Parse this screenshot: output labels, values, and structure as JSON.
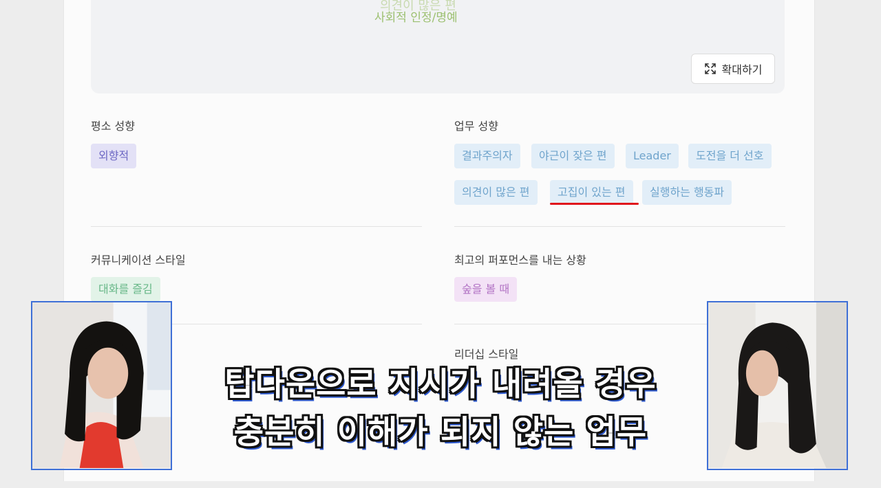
{
  "preview": {
    "cut_text": "의견이 많은 편",
    "honor_text": "사회적 인정/명예",
    "zoom_label": "확대하기"
  },
  "sections": {
    "normal": {
      "title": "평소 성향",
      "chips": [
        "외향적"
      ]
    },
    "work": {
      "title": "업무 성향",
      "chips": [
        "결과주의자",
        "야근이 잦은 편",
        "Leader",
        "도전을 더 선호",
        "의견이 많은 편",
        "고집이 있는 편",
        "실행하는 행동파"
      ]
    },
    "communication": {
      "title": "커뮤니케이션 스타일",
      "chips": [
        "대화를 즐김"
      ]
    },
    "best": {
      "title": "최고의 퍼포먼스를 내는 상황",
      "chips": [
        "숲을 볼 때"
      ]
    },
    "leadership": {
      "title": "리더십 스타일"
    }
  },
  "subtitle": {
    "line1": "탑다운으로 지시가 내려올 경우",
    "line2": "충분히 이해가 되지 않는 업무"
  },
  "colors": {
    "underline": "#e0131b",
    "cam_border": "#3e6fd6"
  }
}
